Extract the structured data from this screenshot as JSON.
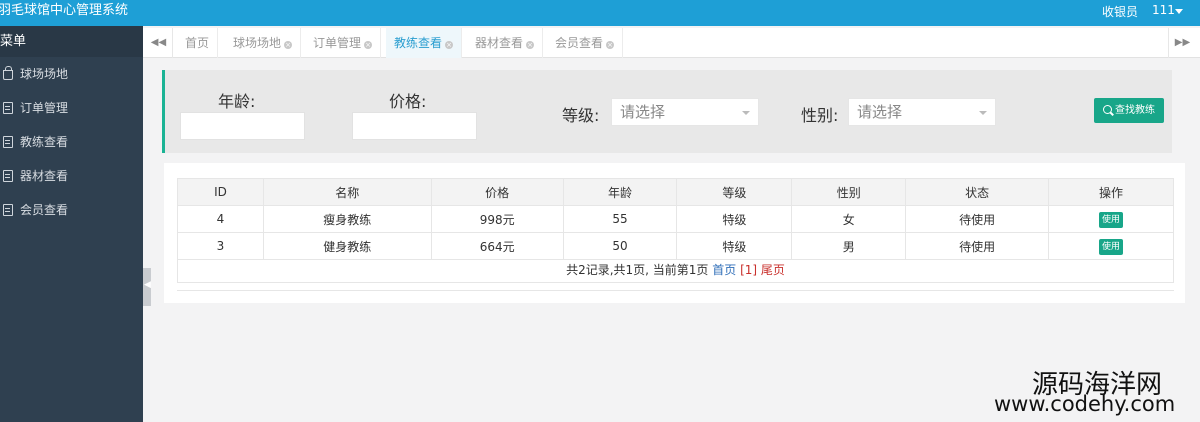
{
  "header": {
    "title": "羽毛球馆中心管理系统",
    "role": "收银员",
    "user": "111"
  },
  "sidebar": {
    "heading": "菜单",
    "items": [
      {
        "label": "球场场地"
      },
      {
        "label": "订单管理"
      },
      {
        "label": "教练查看"
      },
      {
        "label": "器材查看"
      },
      {
        "label": "会员查看"
      }
    ]
  },
  "tabs": [
    {
      "label": "首页"
    },
    {
      "label": "球场场地"
    },
    {
      "label": "订单管理"
    },
    {
      "label": "教练查看"
    },
    {
      "label": "器材查看"
    },
    {
      "label": "会员查看"
    }
  ],
  "search": {
    "age_label": "年龄:",
    "price_label": "价格:",
    "level_label": "等级:",
    "level_value": "请选择",
    "gender_label": "性别:",
    "gender_value": "请选择",
    "button": "查找教练"
  },
  "table": {
    "columns": [
      "ID",
      "名称",
      "价格",
      "年龄",
      "等级",
      "性别",
      "状态",
      "操作"
    ],
    "rows": [
      {
        "id": "4",
        "name": "瘦身教练",
        "price": "998元",
        "age": "55",
        "level": "特级",
        "gender": "女",
        "status": "待使用",
        "action": "使用"
      },
      {
        "id": "3",
        "name": "健身教练",
        "price": "664元",
        "age": "50",
        "level": "特级",
        "gender": "男",
        "status": "待使用",
        "action": "使用"
      }
    ]
  },
  "pager": {
    "summary": "共2记录,共1页, 当前第1页",
    "first": "首页",
    "current": "[1]",
    "last": "尾页"
  },
  "watermark": {
    "cn": "源码海洋网",
    "url": "www.codehy.com"
  },
  "colors": {
    "topbar": "#1e9fd6",
    "sidebar": "#2f4050",
    "accent": "#1ab394",
    "button": "#18a689"
  }
}
